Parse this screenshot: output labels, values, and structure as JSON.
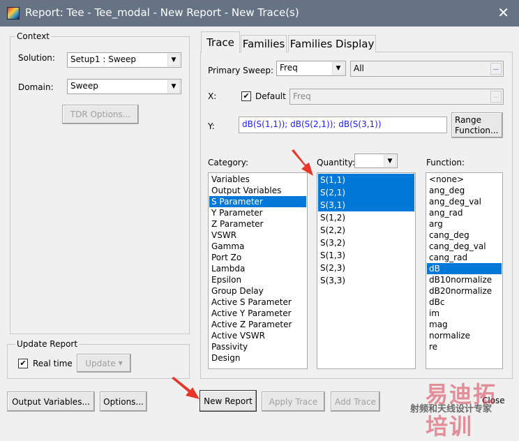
{
  "window": {
    "title": "Report: Tee - Tee_modal - New Report - New Trace(s)",
    "close": "✕"
  },
  "context": {
    "legend": "Context",
    "solution_label": "Solution:",
    "solution_value": "Setup1 : Sweep",
    "domain_label": "Domain:",
    "domain_value": "Sweep",
    "tdr_button": "TDR Options..."
  },
  "update": {
    "legend": "Update Report",
    "realtime_label": "Real time",
    "realtime_checked": true,
    "update_button": "Update"
  },
  "tabs": [
    {
      "label": "Trace",
      "active": true
    },
    {
      "label": "Families"
    },
    {
      "label": "Families Display"
    }
  ],
  "trace": {
    "primary_sweep_label": "Primary Sweep:",
    "primary_sweep_value": "Freq",
    "sweep_range": "All",
    "ellipsis": "...",
    "x_label": "X:",
    "default_label": "Default",
    "default_checked": true,
    "x_value": "Freq",
    "y_label": "Y:",
    "y_value": "dB(S(1,1)); dB(S(2,1)); dB(S(3,1))",
    "range_function_button": "Range\nFunction...",
    "category_label": "Category:",
    "quantity_label": "Quantity:",
    "quantity_filter": "",
    "function_label": "Function:",
    "categories": [
      "Variables",
      "Output Variables",
      "S Parameter",
      "Y Parameter",
      "Z Parameter",
      "VSWR",
      "Gamma",
      "Port Zo",
      "Lambda",
      "Epsilon",
      "Group Delay",
      "Active S Parameter",
      "Active Y Parameter",
      "Active Z Parameter",
      "Active VSWR",
      "Passivity",
      "Design"
    ],
    "selected_category": "S Parameter",
    "quantities": [
      "S(1,1)",
      "S(2,1)",
      "S(3,1)",
      "S(1,2)",
      "S(2,2)",
      "S(3,2)",
      "S(1,3)",
      "S(2,3)",
      "S(3,3)"
    ],
    "selected_quantities": [
      "S(1,1)",
      "S(2,1)",
      "S(3,1)"
    ],
    "functions": [
      "<none>",
      "ang_deg",
      "ang_deg_val",
      "ang_rad",
      "arg",
      "cang_deg",
      "cang_deg_val",
      "cang_rad",
      "dB",
      "dB10normalize",
      "dB20normalize",
      "dBc",
      "im",
      "mag",
      "normalize",
      "re"
    ],
    "selected_function": "dB"
  },
  "buttons": {
    "output_variables": "Output Variables...",
    "options": "Options...",
    "new_report": "New Report",
    "apply_trace": "Apply Trace",
    "add_trace": "Add Trace",
    "close": "Close"
  },
  "watermark": {
    "line1": "易迪拓培训",
    "line2": "射频和天线设计专家"
  },
  "colors": {
    "title_bar": "#667385",
    "selection": "#0078d7",
    "annotation_arrow": "#e8372a",
    "link_text": "#1a1aff"
  }
}
